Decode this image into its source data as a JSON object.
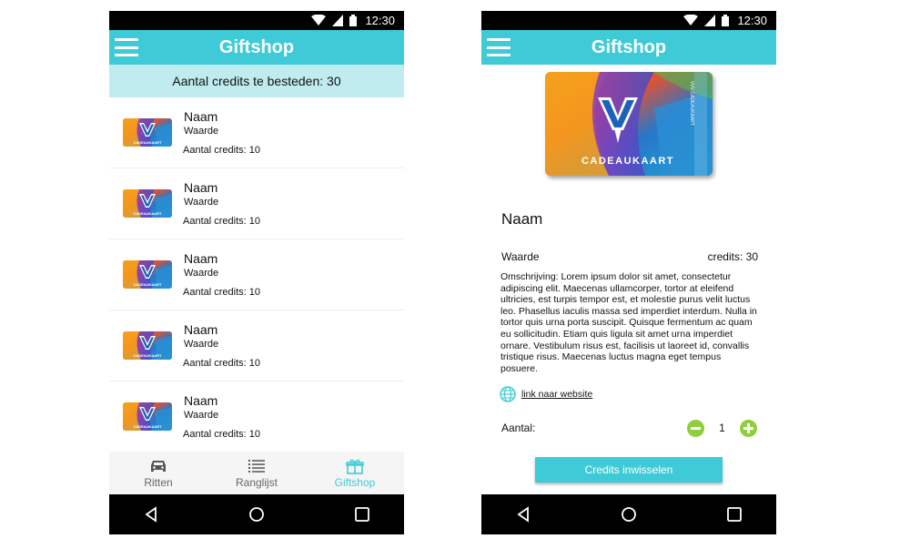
{
  "status_bar": {
    "time": "12:30"
  },
  "colors": {
    "accent": "#3ecbd7",
    "banner": "#c1ecef",
    "stepper": "#8fce3c"
  },
  "list_screen": {
    "title": "Giftshop",
    "credits_banner": "Aantal credits te besteden: 30",
    "items": [
      {
        "name": "Naam",
        "value": "Waarde",
        "credits": "Aantal credits: 10",
        "card_text": "CADEAUKAART"
      },
      {
        "name": "Naam",
        "value": "Waarde",
        "credits": "Aantal credits: 10",
        "card_text": "CADEAUKAART"
      },
      {
        "name": "Naam",
        "value": "Waarde",
        "credits": "Aantal credits: 10",
        "card_text": "CADEAUKAART"
      },
      {
        "name": "Naam",
        "value": "Waarde",
        "credits": "Aantal credits: 10",
        "card_text": "CADEAUKAART"
      },
      {
        "name": "Naam",
        "value": "Waarde",
        "credits": "Aantal credits: 10",
        "card_text": "CADEAUKAART"
      }
    ],
    "bottom_nav": [
      {
        "label": "Ritten",
        "icon": "car-icon",
        "active": false
      },
      {
        "label": "Ranglijst",
        "icon": "list-icon",
        "active": false
      },
      {
        "label": "Giftshop",
        "icon": "gift-icon",
        "active": true
      }
    ]
  },
  "detail_screen": {
    "title": "Giftshop",
    "card_text": "CADEAUKAART",
    "card_side_text": "VVV CADEAUKAART",
    "name": "Naam",
    "value": "Waarde",
    "credits": "credits: 30",
    "description": "Omschrijving: Lorem ipsum dolor sit amet, consectetur adipiscing elit. Maecenas ullamcorper, tortor at eleifend ultricies, est turpis tempor est, et molestie purus velit luctus leo. Phasellus iaculis massa sed imperdiet interdum. Nulla in tortor quis urna porta suscipit. Quisque fermentum ac quam eu sollicitudin. Etiam quis ligula sit amet urna imperdiet ornare. Vestibulum risus est, facilisis ut laoreet id, convallis tristique risus. Maecenas luctus magna eget tempus posuere.",
    "link_text": "link naar website",
    "quantity_label": "Aantal:",
    "quantity": "1",
    "redeem_button": "Credits inwisselen"
  }
}
